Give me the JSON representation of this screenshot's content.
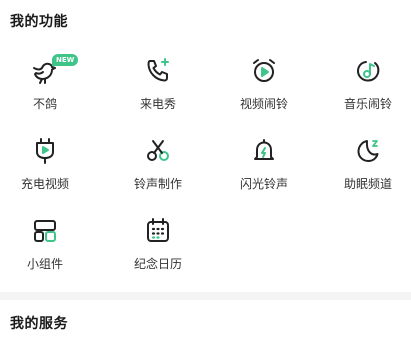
{
  "features": {
    "title": "我的功能",
    "items": [
      {
        "label": "不鸽",
        "icon": "bird-icon",
        "badge": "NEW"
      },
      {
        "label": "来电秀",
        "icon": "phone-sparkle-icon"
      },
      {
        "label": "视频闹铃",
        "icon": "alarm-clock-play-icon"
      },
      {
        "label": "音乐闹铃",
        "icon": "music-note-circle-icon"
      },
      {
        "label": "充电视频",
        "icon": "charger-plug-play-icon"
      },
      {
        "label": "铃声制作",
        "icon": "scissors-icon"
      },
      {
        "label": "闪光铃声",
        "icon": "bell-flash-icon"
      },
      {
        "label": "助眠频道",
        "icon": "moon-sleep-icon"
      },
      {
        "label": "小组件",
        "icon": "widget-grid-icon"
      },
      {
        "label": "纪念日历",
        "icon": "calendar-icon"
      }
    ]
  },
  "services": {
    "title": "我的服务"
  },
  "colors": {
    "icon_stroke": "#222222",
    "accent": "#3fc48a",
    "divider": "#f4f4f4"
  }
}
